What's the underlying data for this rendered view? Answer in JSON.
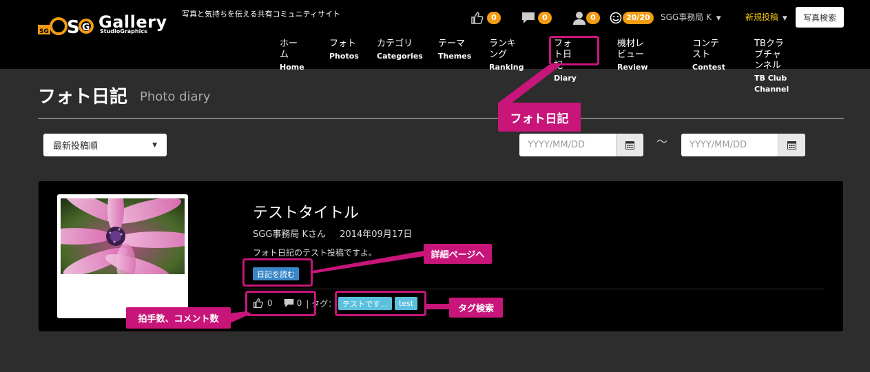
{
  "header": {
    "logo_text": "Gallery",
    "logo_sub": "StudioGraphics",
    "tagline": "写真と気持ちを伝える共有コミュニティサイト",
    "like_count": "0",
    "comment_count": "0",
    "follower_count": "0",
    "smile_count": "20/20",
    "user_menu": "SGG事務局 K",
    "new_post": "新規投稿",
    "photo_search": "写真検索"
  },
  "nav": [
    {
      "jp": "ホーム",
      "en": "Home"
    },
    {
      "jp": "フォト",
      "en": "Photos"
    },
    {
      "jp": "カテゴリ",
      "en": "Categories"
    },
    {
      "jp": "テーマ",
      "en": "Themes"
    },
    {
      "jp": "ランキング",
      "en": "Ranking"
    },
    {
      "jp": "フォト日記",
      "en": "Diary"
    },
    {
      "jp": "機材レビュー",
      "en": "Review"
    },
    {
      "jp": "コンテスト",
      "en": "Contest"
    },
    {
      "jp": "TBクラブチャンネル",
      "en": "TB Club Channel"
    }
  ],
  "page": {
    "title": "フォト日記",
    "subtitle": "Photo diary"
  },
  "filters": {
    "sort_selected": "最新投稿順",
    "date_from_placeholder": "YYYY/MM/DD",
    "date_to_placeholder": "YYYY/MM/DD",
    "range_separator": "～"
  },
  "entry": {
    "title": "テストタイトル",
    "author": "SGG事務局 Kさん",
    "date": "2014年09月17日",
    "text": "フォト日記のテスト投稿ですよ。",
    "read_button": "日記を読む",
    "likes": "0",
    "comments": "0",
    "tag_label": "| タグ：",
    "tags": [
      "テストです...",
      "test"
    ]
  },
  "annotations": {
    "diary": "フォト日記",
    "detail": "詳細ページへ",
    "tag_search": "タグ検索",
    "counts": "拍手数、コメント数"
  },
  "colors": {
    "accent": "#c8157a",
    "badge": "#f39c12",
    "read_button": "#3a87c8",
    "tag": "#5bc0de"
  }
}
